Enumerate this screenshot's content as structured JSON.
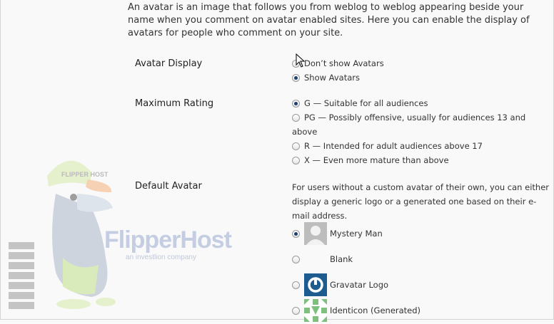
{
  "intro": "An avatar is an image that follows you from weblog to weblog appearing beside your name when you comment on avatar enabled sites. Here you can enable the display of avatars for people who comment on your site.",
  "avatar_display": {
    "label": "Avatar Display",
    "options": [
      {
        "label": "Don’t show Avatars",
        "selected": false
      },
      {
        "label": "Show Avatars",
        "selected": true
      }
    ]
  },
  "maximum_rating": {
    "label": "Maximum Rating",
    "options": [
      {
        "label": "G — Suitable for all audiences",
        "selected": true
      },
      {
        "label": "PG — Possibly offensive, usually for audiences 13 and above",
        "selected": false
      },
      {
        "label": "R — Intended for adult audiences above 17",
        "selected": false
      },
      {
        "label": "X — Even more mature than above",
        "selected": false
      }
    ]
  },
  "default_avatar": {
    "label": "Default Avatar",
    "description": "For users without a custom avatar of their own, you can either display a generic logo or a generated one based on their e-mail address.",
    "options": [
      {
        "label": "Mystery Man",
        "selected": true,
        "icon": "mystery-man-icon"
      },
      {
        "label": "Blank",
        "selected": false,
        "icon": "blank-icon"
      },
      {
        "label": "Gravatar Logo",
        "selected": false,
        "icon": "gravatar-logo-icon"
      },
      {
        "label": "Identicon (Generated)",
        "selected": false,
        "icon": "identicon-icon"
      }
    ]
  },
  "watermark": {
    "brand": "FlipperHost",
    "tagline": "an investlion company",
    "cap_text": "FLIPPER HOST"
  },
  "colors": {
    "selected_radio": "#1f3e6b",
    "gravatar_blue": "#1e5b8e",
    "identicon_green": "#7fbf7f"
  }
}
